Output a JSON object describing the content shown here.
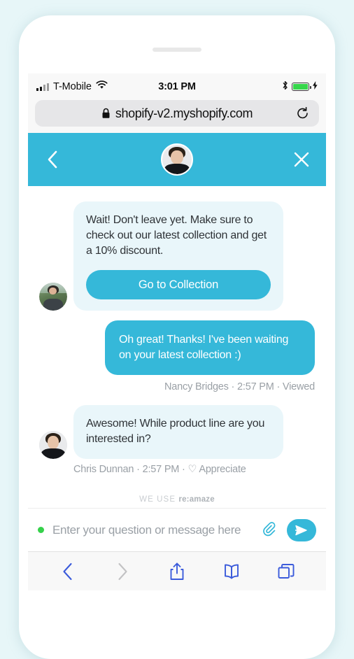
{
  "status_bar": {
    "carrier": "T-Mobile",
    "time": "3:01 PM",
    "signal_icon": "cellular-signal-icon",
    "wifi_icon": "wifi-icon",
    "bluetooth_icon": "bluetooth-icon",
    "battery_icon": "battery-full-icon",
    "charging_icon": "lightning-bolt-icon"
  },
  "browser": {
    "url": "shopify-v2.myshopify.com",
    "lock_icon": "lock-icon",
    "reload_icon": "reload-icon",
    "toolbar": {
      "back_icon": "chevron-left-icon",
      "forward_icon": "chevron-right-icon",
      "share_icon": "share-icon",
      "bookmarks_icon": "book-icon",
      "tabs_icon": "tabs-icon"
    }
  },
  "chat_header": {
    "back_icon": "chevron-left-icon",
    "close_icon": "close-icon",
    "avatar_icon": "agent-avatar"
  },
  "conversation": {
    "messages": [
      {
        "id": "msg-promo",
        "direction": "incoming",
        "text": "Wait! Don't leave yet. Make sure to check out our latest collection and get a 10% discount.",
        "cta_label": "Go to Collection",
        "avatar_icon": "nancy-avatar"
      },
      {
        "id": "msg-reply",
        "direction": "outgoing",
        "text": "Oh great! Thanks! I've been waiting on your latest collection :)",
        "meta": "Nancy Bridges · 2:57 PM · Viewed"
      },
      {
        "id": "msg-question",
        "direction": "incoming",
        "text": "Awesome! While product line are you interested in?",
        "author": "Chris Dunnan",
        "time": "2:57 PM",
        "appreciate_label": "Appreciate",
        "appreciate_icon": "heart-icon",
        "avatar_icon": "chris-avatar"
      }
    ],
    "branding_prefix": "WE USE",
    "branding_name": "re:amaze"
  },
  "composer": {
    "placeholder": "Enter your question or message here",
    "value": "",
    "online_indicator": "online-dot",
    "attach_icon": "paperclip-icon",
    "send_icon": "send-icon"
  },
  "colors": {
    "accent": "#35b8d9",
    "bubble_incoming": "#e9f6fa",
    "page_background": "#e7f6f8",
    "online": "#35d14a",
    "safari_blue": "#3b5bdb"
  }
}
